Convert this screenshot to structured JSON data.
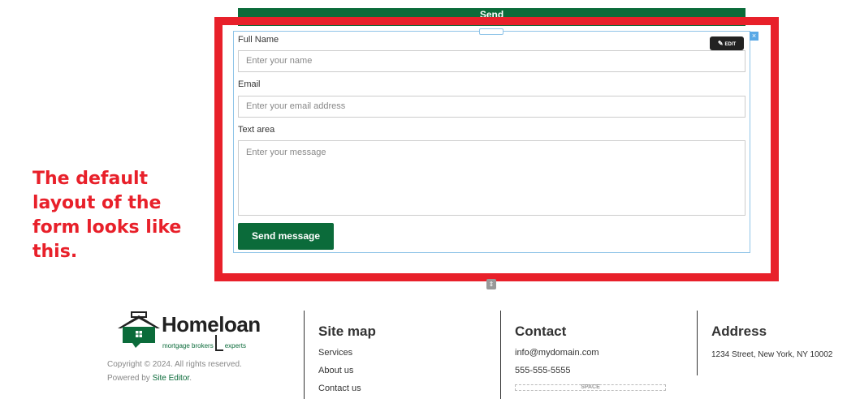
{
  "top_send_label": "Send",
  "form": {
    "edit_label": "EDIT",
    "close_glyph": "×",
    "fields": [
      {
        "label": "Full Name",
        "placeholder": "Enter your name"
      },
      {
        "label": "Email",
        "placeholder": "Enter your email address"
      },
      {
        "label": "Text area",
        "placeholder": "Enter your message"
      }
    ],
    "submit_label": "Send message"
  },
  "note": "The default layout of the form looks like this.",
  "colors": {
    "brand_green": "#0b6b3a",
    "highlight_red": "#e8202a",
    "selection_blue": "#8fc4e8"
  },
  "footer": {
    "logo": {
      "name": "Homeloan",
      "tagline_left": "mortgage brokers",
      "tagline_right": "experts"
    },
    "copyright": "Copyright © 2024. All rights reserved.",
    "powered_prefix": "Powered by ",
    "powered_link": "Site Editor",
    "powered_suffix": ".",
    "sitemap": {
      "title": "Site map",
      "items": [
        "Services",
        "About us",
        "Contact us"
      ]
    },
    "contact": {
      "title": "Contact",
      "email": "info@mydomain.com",
      "phone": "555-555-5555",
      "space_label": "SPACE"
    },
    "address": {
      "title": "Address",
      "line": "1234 Street, New York, NY 10002"
    }
  }
}
